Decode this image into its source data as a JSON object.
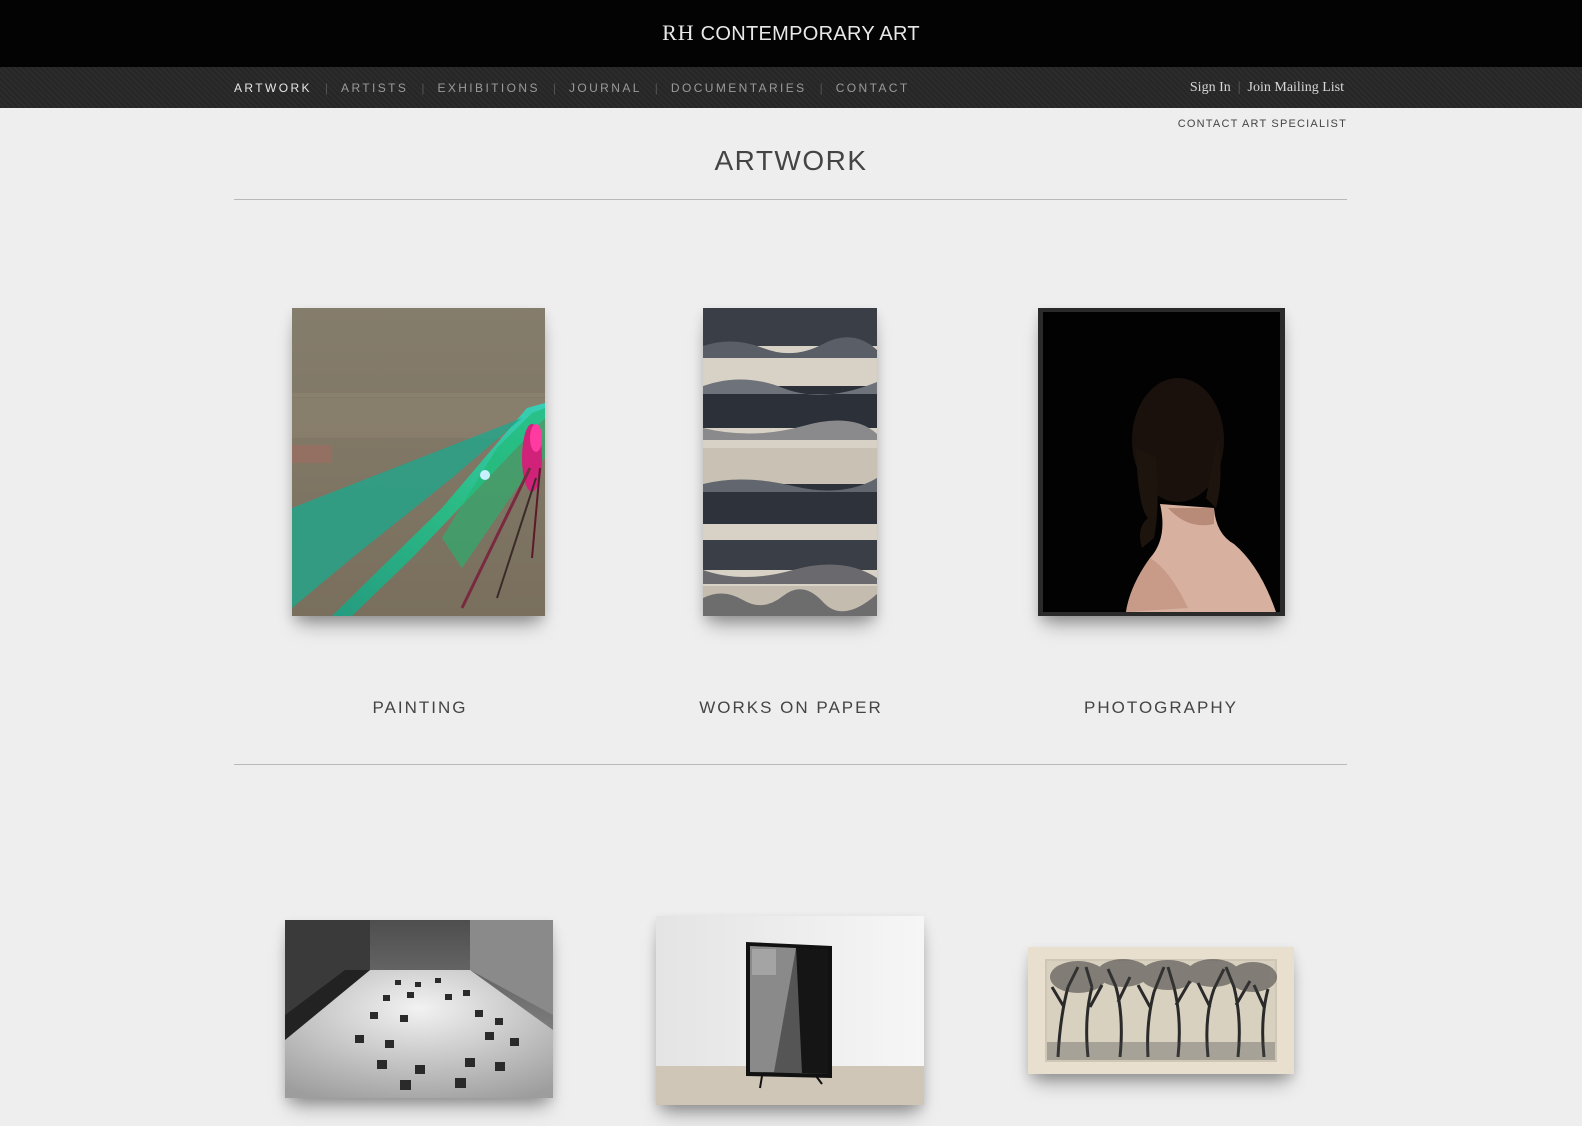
{
  "header": {
    "brand_mark": "RH",
    "brand_name": "CONTEMPORARY ART"
  },
  "nav": {
    "items": [
      {
        "label": "ARTWORK",
        "active": true
      },
      {
        "label": "ARTISTS",
        "active": false
      },
      {
        "label": "EXHIBITIONS",
        "active": false
      },
      {
        "label": "JOURNAL",
        "active": false
      },
      {
        "label": "DOCUMENTARIES",
        "active": false
      },
      {
        "label": "CONTACT",
        "active": false
      }
    ],
    "separator": "|",
    "sign_in": "Sign In",
    "mailing_list": "Join Mailing List"
  },
  "contact_specialist": "CONTACT ART SPECIALIST",
  "page": {
    "title": "ARTWORK"
  },
  "categories": [
    {
      "label": "PAINTING"
    },
    {
      "label": "WORKS ON PAPER"
    },
    {
      "label": "PHOTOGRAPHY"
    }
  ],
  "colors": {
    "topbar": "#030303",
    "navbar": "#292929",
    "background": "#eeeeee",
    "text": "#444444",
    "rule": "#b9b9b9"
  }
}
